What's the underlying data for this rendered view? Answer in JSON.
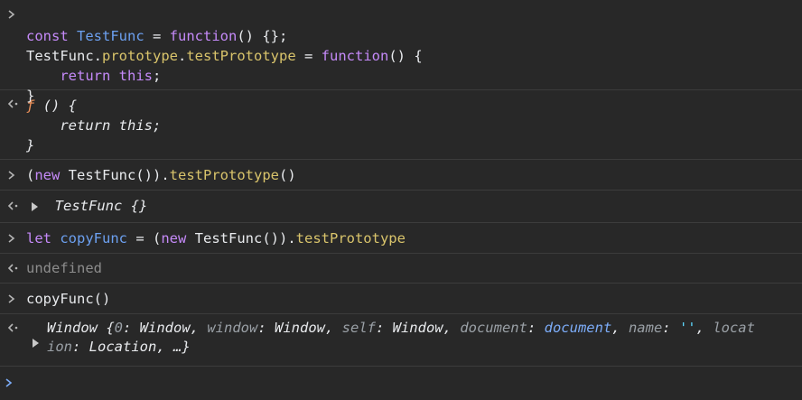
{
  "entries": [
    {
      "type": "input",
      "lines": [
        [
          [
            "kw",
            "const"
          ],
          [
            "sp",
            " "
          ],
          [
            "id",
            "TestFunc"
          ],
          [
            "fn",
            " = "
          ],
          [
            "kw",
            "function"
          ],
          [
            "fn",
            "() {};"
          ]
        ],
        [
          [
            "fn",
            "TestFunc."
          ],
          [
            "prop",
            "prototype"
          ],
          [
            "fn",
            "."
          ],
          [
            "prop",
            "testPrototype"
          ],
          [
            "fn",
            " = "
          ],
          [
            "kw",
            "function"
          ],
          [
            "fn",
            "() {"
          ]
        ],
        [
          [
            "fn",
            "    "
          ],
          [
            "kw",
            "return"
          ],
          [
            "sp",
            " "
          ],
          [
            "kw",
            "this"
          ],
          [
            "fn",
            ";"
          ]
        ],
        [
          [
            "fn",
            "}"
          ]
        ]
      ]
    },
    {
      "type": "output",
      "f_glyph": "ƒ",
      "lines": [
        " () {",
        "    return this;",
        "}"
      ]
    },
    {
      "type": "input",
      "text": {
        "open": "(",
        "new": "new",
        "ctor": " TestFunc())",
        "dot": ".",
        "method": "testPrototype",
        "call": "()"
      }
    },
    {
      "type": "output",
      "object_preview": "TestFunc {}"
    },
    {
      "type": "input",
      "text": {
        "let": "let",
        "var": "copyFunc",
        "eq": " = (",
        "new": "new",
        "ctor": " TestFunc())",
        "dot": ".",
        "method": "testPrototype"
      }
    },
    {
      "type": "output",
      "value": "undefined"
    },
    {
      "type": "input",
      "value": "copyFunc()"
    },
    {
      "type": "output",
      "window_preview": {
        "line1_parts": {
          "a": "Window {",
          "b": "0",
          "c": ": Window, ",
          "d": "window",
          "e": ": Window, ",
          "f": "self",
          "g": ": Window, ",
          "h": "document",
          "i": ": ",
          "j": "document",
          "k": ", ",
          "l": "name",
          "m": ": ",
          "n": "''",
          "o": ", ",
          "p": "locat"
        },
        "line2_parts": {
          "a": "ion",
          "b": ": Location, …}"
        }
      }
    }
  ],
  "prompt_symbol": ">",
  "colors": {
    "background": "#282828",
    "keyword": "#c58af9",
    "identifier": "#6ca0f0",
    "property": "#d9c46b",
    "function_glyph": "#ee9159",
    "prompt_blue": "#7cacf8"
  }
}
